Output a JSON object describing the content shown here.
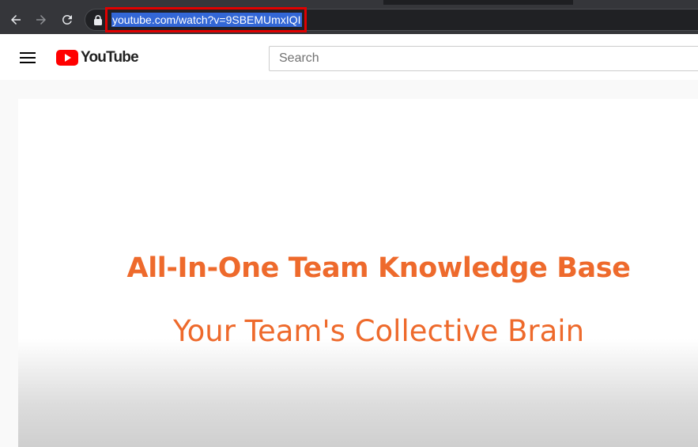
{
  "browser": {
    "url": "youtube.com/watch?v=9SBEMUmxIQI",
    "icons": {
      "back": "arrow-left-icon",
      "forward": "arrow-right-icon",
      "reload": "reload-icon",
      "lock": "lock-icon"
    },
    "colors": {
      "toolbar": "#35363a",
      "omnibox": "#202124",
      "url_selection": "#3367d6",
      "highlight_box": "#e00000"
    }
  },
  "youtube": {
    "logo_text": "YouTube",
    "search": {
      "placeholder": "Search",
      "value": ""
    },
    "icons": {
      "menu": "hamburger-menu-icon",
      "logo": "youtube-logo-icon"
    },
    "colors": {
      "brand_red": "#ff0000"
    }
  },
  "video": {
    "headline": "All-In-One Team Knowledge Base",
    "subline": "Your Team's Collective Brain",
    "colors": {
      "text_accent": "#ee6a2c"
    }
  }
}
